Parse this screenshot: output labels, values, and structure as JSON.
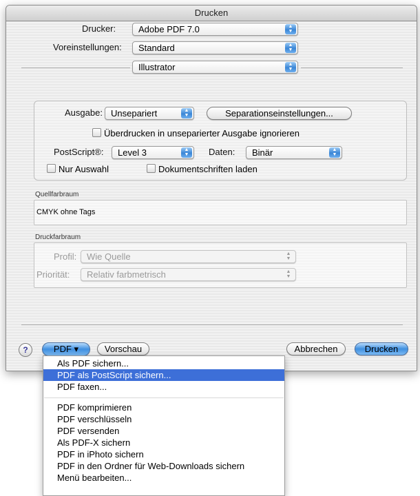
{
  "window": {
    "title": "Drucken"
  },
  "printer": {
    "label": "Drucker:",
    "value": "Adobe PDF 7.0"
  },
  "presets": {
    "label": "Voreinstellungen:",
    "value": "Standard"
  },
  "pane": {
    "value": "Illustrator"
  },
  "output": {
    "ausgabe_label": "Ausgabe:",
    "ausgabe_value": "Unsepariert",
    "separation_button": "Separationseinstellungen...",
    "overprint_ignore": "Überdrucken in unseparierter Ausgabe ignorieren",
    "postscript_label": "PostScript®:",
    "postscript_value": "Level 3",
    "daten_label": "Daten:",
    "daten_value": "Binär",
    "nur_auswahl": "Nur Auswahl",
    "dokumentschriften": "Dokumentschriften laden"
  },
  "source": {
    "group_label": "Quellfarbraum",
    "value": "CMYK ohne Tags"
  },
  "print_space": {
    "group_label": "Druckfarbraum",
    "profile_label": "Profil:",
    "profile_value": "Wie Quelle",
    "intent_label": "Priorität:",
    "intent_value": "Relativ farbmetrisch"
  },
  "footer": {
    "help": "?",
    "pdf_button": "PDF ▾",
    "preview_button": "Vorschau",
    "cancel_button": "Abbrechen",
    "print_button": "Drucken"
  },
  "pdf_menu": {
    "items": [
      "Als PDF sichern...",
      "PDF als PostScript sichern...",
      "PDF faxen...",
      "PDF komprimieren",
      "PDF verschlüsseln",
      "PDF versenden",
      "Als PDF-X sichern",
      "PDF in iPhoto sichern",
      "PDF in den Ordner für Web-Downloads sichern",
      "Menü bearbeiten..."
    ],
    "selected_index": 1
  },
  "colors": {
    "accent": "#3d6fd8",
    "button_blue": "#3f8fe0"
  }
}
